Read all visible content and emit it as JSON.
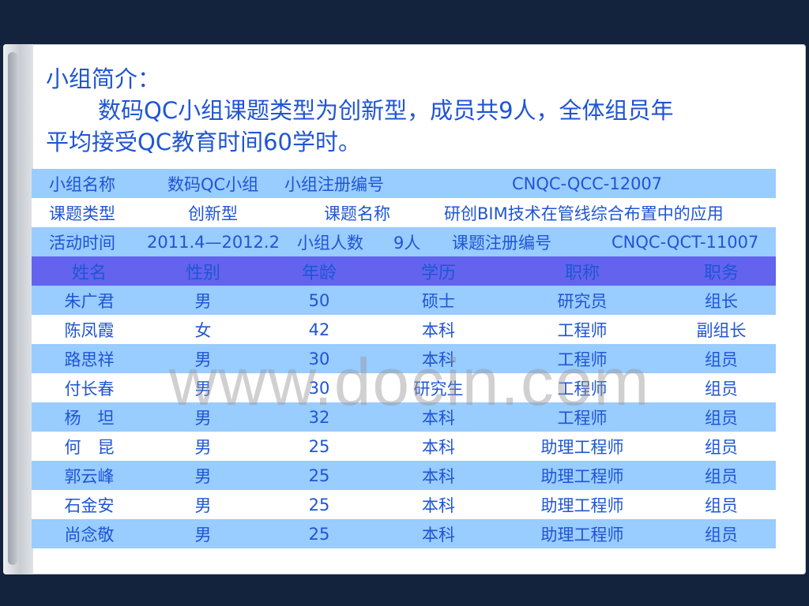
{
  "intro": {
    "heading": "小组简介：",
    "line1": "数码QC小组课题类型为创新型，成员共9人，全体组员年",
    "line2": "平均接受QC教育时间60学时。"
  },
  "info_rows": [
    {
      "label1": "小组名称",
      "value1": "数码QC小组",
      "label2": "小组注册编号",
      "value2": "CNQC-QCC-12007"
    },
    {
      "label1": "课题类型",
      "value1": "创新型",
      "label2": "课题名称",
      "value2": "研创BIM技术在管线综合布置中的应用"
    },
    {
      "label1": "活动时间",
      "value1": "2011.4—2012.2",
      "label2": "小组人数",
      "value2": "9人",
      "label3": "课题注册编号",
      "value3": "CNQC-QCT-11007"
    }
  ],
  "table": {
    "headers": [
      "姓名",
      "性别",
      "年龄",
      "学历",
      "职称",
      "职务"
    ],
    "rows": [
      [
        "朱广君",
        "男",
        "50",
        "硕士",
        "研究员",
        "组长"
      ],
      [
        "陈凤霞",
        "女",
        "42",
        "本科",
        "工程师",
        "副组长"
      ],
      [
        "路思祥",
        "男",
        "30",
        "本科",
        "工程师",
        "组员"
      ],
      [
        "付长春",
        "男",
        "30",
        "研究生",
        "工程师",
        "组员"
      ],
      [
        "杨　坦",
        "男",
        "32",
        "本科",
        "工程师",
        "组员"
      ],
      [
        "何　昆",
        "男",
        "25",
        "本科",
        "助理工程师",
        "组员"
      ],
      [
        "郭云峰",
        "男",
        "25",
        "本科",
        "助理工程师",
        "组员"
      ],
      [
        "石金安",
        "男",
        "25",
        "本科",
        "助理工程师",
        "组员"
      ],
      [
        "尚念敬",
        "男",
        "25",
        "本科",
        "助理工程师",
        "组员"
      ]
    ]
  },
  "watermark": "www.docin.com",
  "colors": {
    "text": "#1f55d4",
    "row_blue": "#99ccff",
    "header": "#6363ee",
    "background": "#13233d"
  }
}
